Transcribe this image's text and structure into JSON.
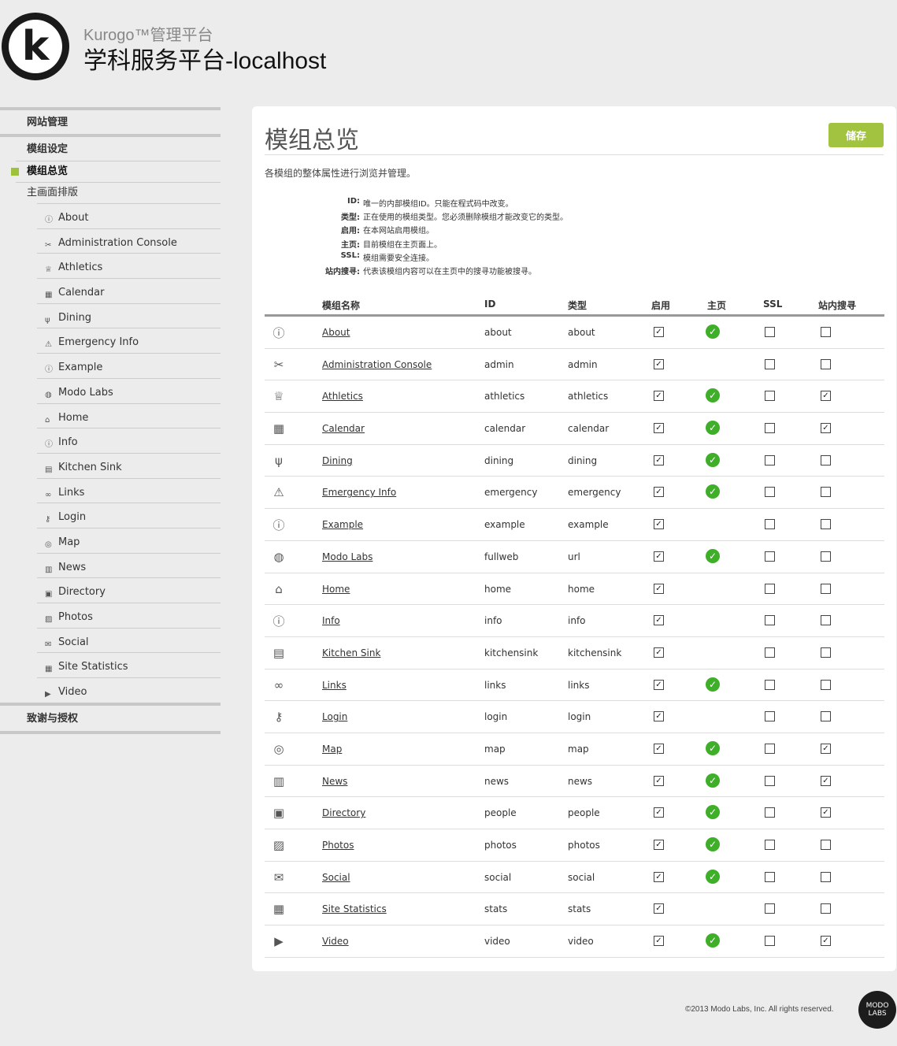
{
  "header": {
    "platform": "Kurogo™管理平台",
    "site": "学科服务平台-localhost"
  },
  "sidebar": {
    "site_admin": "网站管理",
    "module_settings": "模组设定",
    "module_overview": "模组总览",
    "homescreen_layout": "主画面排版",
    "modules": [
      {
        "label": "About",
        "icon": "info-icon"
      },
      {
        "label": "Administration Console",
        "icon": "tools-icon"
      },
      {
        "label": "Athletics",
        "icon": "trophy-icon"
      },
      {
        "label": "Calendar",
        "icon": "calendar-icon"
      },
      {
        "label": "Dining",
        "icon": "dining-icon"
      },
      {
        "label": "Emergency Info",
        "icon": "warning-icon"
      },
      {
        "label": "Example",
        "icon": "info-icon"
      },
      {
        "label": "Modo Labs",
        "icon": "globe-icon"
      },
      {
        "label": "Home",
        "icon": "home-icon"
      },
      {
        "label": "Info",
        "icon": "info-icon"
      },
      {
        "label": "Kitchen Sink",
        "icon": "kitchensink-icon"
      },
      {
        "label": "Links",
        "icon": "link-icon"
      },
      {
        "label": "Login",
        "icon": "login-icon"
      },
      {
        "label": "Map",
        "icon": "map-icon"
      },
      {
        "label": "News",
        "icon": "news-icon"
      },
      {
        "label": "Directory",
        "icon": "directory-icon"
      },
      {
        "label": "Photos",
        "icon": "photos-icon"
      },
      {
        "label": "Social",
        "icon": "social-icon"
      },
      {
        "label": "Site Statistics",
        "icon": "stats-icon"
      },
      {
        "label": "Video",
        "icon": "video-icon"
      }
    ],
    "credits": "致谢与授权"
  },
  "main": {
    "title": "模组总览",
    "save_label": "储存",
    "description": "各模组的整体属性进行浏览并管理。",
    "legend": [
      {
        "key": "ID:",
        "text": "唯一的内部模组ID。只能在程式码中改变。"
      },
      {
        "key": "类型:",
        "text": "正在使用的模组类型。您必须删除模组才能改变它的类型。"
      },
      {
        "key": "启用:",
        "text": "在本网站启用模组。"
      },
      {
        "key": "主页:",
        "text": "目前模组在主页面上。"
      },
      {
        "key": "SSL:",
        "text": "模组需要安全连接。"
      },
      {
        "key": "站内搜寻:",
        "text": "代表该模组内容可以在主页中的搜寻功能被搜寻。"
      }
    ],
    "columns": {
      "name": "模组名称",
      "id": "ID",
      "type": "类型",
      "enabled": "启用",
      "home": "主页",
      "ssl": "SSL",
      "search": "站内搜寻"
    },
    "rows": [
      {
        "name": "About",
        "id": "about",
        "type": "about",
        "enabled": true,
        "home": true,
        "ssl": false,
        "search": false,
        "icon": "info-icon"
      },
      {
        "name": "Administration Console",
        "id": "admin",
        "type": "admin",
        "enabled": true,
        "home": false,
        "ssl": false,
        "search": false,
        "icon": "tools-icon"
      },
      {
        "name": "Athletics",
        "id": "athletics",
        "type": "athletics",
        "enabled": true,
        "home": true,
        "ssl": false,
        "search": true,
        "icon": "trophy-icon"
      },
      {
        "name": "Calendar",
        "id": "calendar",
        "type": "calendar",
        "enabled": true,
        "home": true,
        "ssl": false,
        "search": true,
        "icon": "calendar-icon"
      },
      {
        "name": "Dining",
        "id": "dining",
        "type": "dining",
        "enabled": true,
        "home": true,
        "ssl": false,
        "search": false,
        "icon": "dining-icon"
      },
      {
        "name": "Emergency Info",
        "id": "emergency",
        "type": "emergency",
        "enabled": true,
        "home": true,
        "ssl": false,
        "search": false,
        "icon": "warning-icon"
      },
      {
        "name": "Example",
        "id": "example",
        "type": "example",
        "enabled": true,
        "home": false,
        "ssl": false,
        "search": false,
        "icon": "info-icon"
      },
      {
        "name": "Modo Labs",
        "id": "fullweb",
        "type": "url",
        "enabled": true,
        "home": true,
        "ssl": false,
        "search": false,
        "icon": "globe-icon"
      },
      {
        "name": "Home",
        "id": "home",
        "type": "home",
        "enabled": true,
        "home": false,
        "ssl": false,
        "search": false,
        "icon": "home-icon"
      },
      {
        "name": "Info",
        "id": "info",
        "type": "info",
        "enabled": true,
        "home": false,
        "ssl": false,
        "search": false,
        "icon": "info-icon"
      },
      {
        "name": "Kitchen Sink",
        "id": "kitchensink",
        "type": "kitchensink",
        "enabled": true,
        "home": false,
        "ssl": false,
        "search": false,
        "icon": "kitchensink-icon"
      },
      {
        "name": "Links",
        "id": "links",
        "type": "links",
        "enabled": true,
        "home": true,
        "ssl": false,
        "search": false,
        "icon": "link-icon"
      },
      {
        "name": "Login",
        "id": "login",
        "type": "login",
        "enabled": true,
        "home": false,
        "ssl": false,
        "search": false,
        "icon": "login-icon"
      },
      {
        "name": "Map",
        "id": "map",
        "type": "map",
        "enabled": true,
        "home": true,
        "ssl": false,
        "search": true,
        "icon": "map-icon"
      },
      {
        "name": "News",
        "id": "news",
        "type": "news",
        "enabled": true,
        "home": true,
        "ssl": false,
        "search": true,
        "icon": "news-icon"
      },
      {
        "name": "Directory",
        "id": "people",
        "type": "people",
        "enabled": true,
        "home": true,
        "ssl": false,
        "search": true,
        "icon": "directory-icon"
      },
      {
        "name": "Photos",
        "id": "photos",
        "type": "photos",
        "enabled": true,
        "home": true,
        "ssl": false,
        "search": false,
        "icon": "photos-icon"
      },
      {
        "name": "Social",
        "id": "social",
        "type": "social",
        "enabled": true,
        "home": true,
        "ssl": false,
        "search": false,
        "icon": "social-icon"
      },
      {
        "name": "Site Statistics",
        "id": "stats",
        "type": "stats",
        "enabled": true,
        "home": false,
        "ssl": false,
        "search": false,
        "icon": "stats-icon"
      },
      {
        "name": "Video",
        "id": "video",
        "type": "video",
        "enabled": true,
        "home": true,
        "ssl": false,
        "search": true,
        "icon": "video-icon"
      }
    ]
  },
  "footer": {
    "copyright": "©2013 Modo Labs, Inc. All rights reserved.",
    "logo_text": "MODO LABS"
  },
  "colors": {
    "accent": "#a2c33f",
    "home_ok": "#3fae29",
    "background": "#ececec"
  }
}
